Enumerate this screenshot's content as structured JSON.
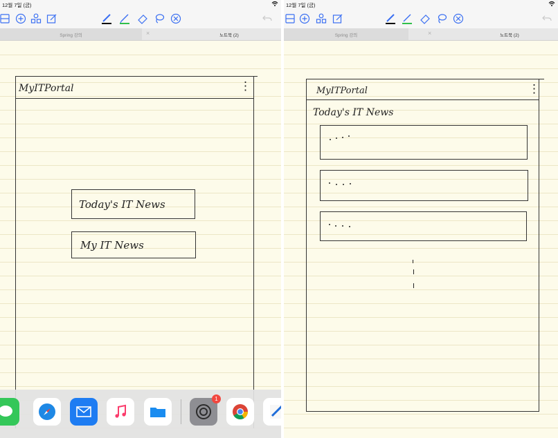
{
  "left_pane": {
    "status": {
      "time": "12월 7일 (금)",
      "wifi": "⌔"
    },
    "tabs": {
      "first": "Spring 강의",
      "close": "×",
      "second": "노트북 (2)"
    },
    "note": {
      "header_title": "MyITPortal",
      "menu_glyph": "⋮",
      "buttons": [
        "Today's IT News",
        "My IT News"
      ]
    },
    "dock": {
      "badge_count": "1",
      "apps": [
        "messages-icon",
        "safari-icon",
        "mail-icon",
        "music-icon",
        "files-icon",
        "settings-icon",
        "chrome-icon",
        "notes-icon"
      ]
    }
  },
  "right_pane": {
    "status": {
      "time": "12월 7일 (금)",
      "wifi": "⌔"
    },
    "tabs": {
      "first": "Spring 강의",
      "close": "×",
      "second": "노트북 (2)"
    },
    "note": {
      "header_title": "MyITPortal",
      "menu_glyph": "⋮",
      "section_title": "Today's IT News",
      "item_count": 3
    }
  },
  "colors": {
    "paper": "#fdfbea",
    "rule": "#ece6c6",
    "ink": "#222222",
    "pen_black": "#000000",
    "pen_green": "#2fbf4a",
    "tool_blue": "#3a6ff2",
    "badge_red": "#f2473f"
  }
}
